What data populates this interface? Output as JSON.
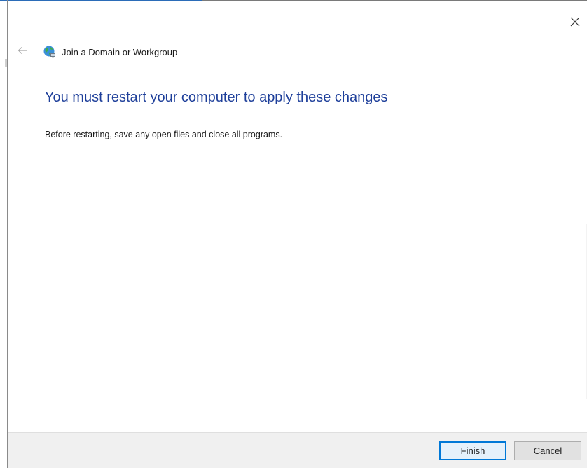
{
  "window": {
    "title": "Join a Domain or Workgroup",
    "icon": "network-globe-icon",
    "close_icon": "close-icon",
    "back_icon": "back-arrow-icon"
  },
  "content": {
    "heading": "You must restart your computer to apply these changes",
    "body": "Before restarting, save any open files and close all programs."
  },
  "footer": {
    "finish_label": "Finish",
    "cancel_label": "Cancel"
  },
  "colors": {
    "heading": "#1e3f9a",
    "default_button_border": "#0078d7",
    "footer_background": "#f0f0f0"
  }
}
